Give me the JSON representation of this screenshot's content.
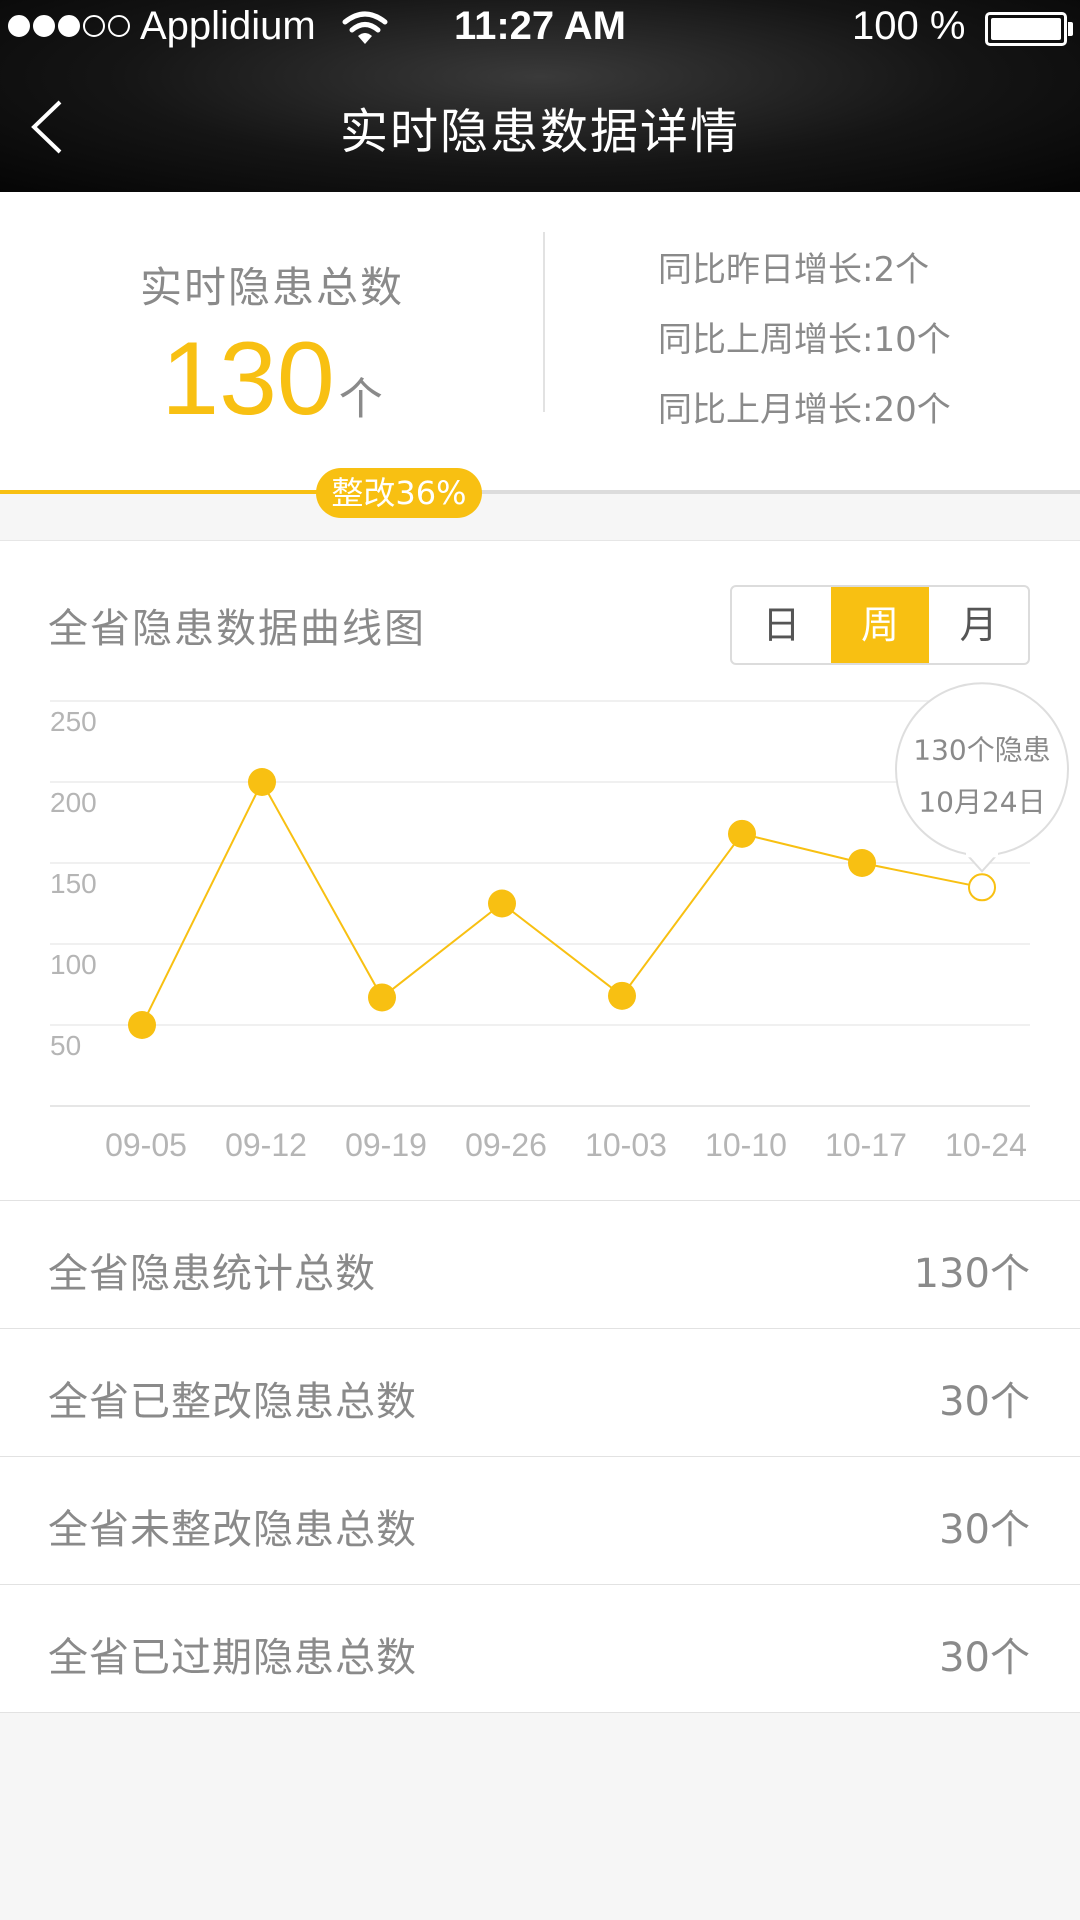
{
  "status_bar": {
    "carrier": "Applidium",
    "time": "11:27 AM",
    "battery": "100 %"
  },
  "nav": {
    "title": "实时隐患数据详情",
    "back_icon": "chevron-left-icon"
  },
  "summary": {
    "label": "实时隐患总数",
    "total": "130",
    "unit": "个",
    "growth": [
      "同比昨日增长:2个",
      "同比上周增长:10个",
      "同比上月增长:20个"
    ],
    "progress_label": "整改36%",
    "progress_value": 0.36
  },
  "chart_section": {
    "title": "全省隐患数据曲线图",
    "tabs": [
      "日",
      "周",
      "月"
    ],
    "active_tab": "周"
  },
  "chart_data": {
    "type": "line",
    "categories": [
      "09-05",
      "09-12",
      "09-19",
      "09-26",
      "10-03",
      "10-10",
      "10-17",
      "10-24"
    ],
    "values": [
      50,
      200,
      67,
      125,
      68,
      168,
      150,
      135
    ],
    "y_ticks": [
      50,
      100,
      150,
      200,
      250
    ],
    "ylim": [
      0,
      250
    ],
    "tooltip": {
      "line1": "130个隐患",
      "line2": "10月24日"
    },
    "accent": "#f8c012"
  },
  "stats": [
    {
      "label": "全省隐患统计总数",
      "value": "130个"
    },
    {
      "label": "全省已整改隐患总数",
      "value": "30个"
    },
    {
      "label": "全省未整改隐患总数",
      "value": "30个"
    },
    {
      "label": "全省已过期隐患总数",
      "value": "30个"
    }
  ],
  "colors": {
    "accent": "#f8c012",
    "text": "#8a8a8a",
    "header_bg": "#111111"
  }
}
